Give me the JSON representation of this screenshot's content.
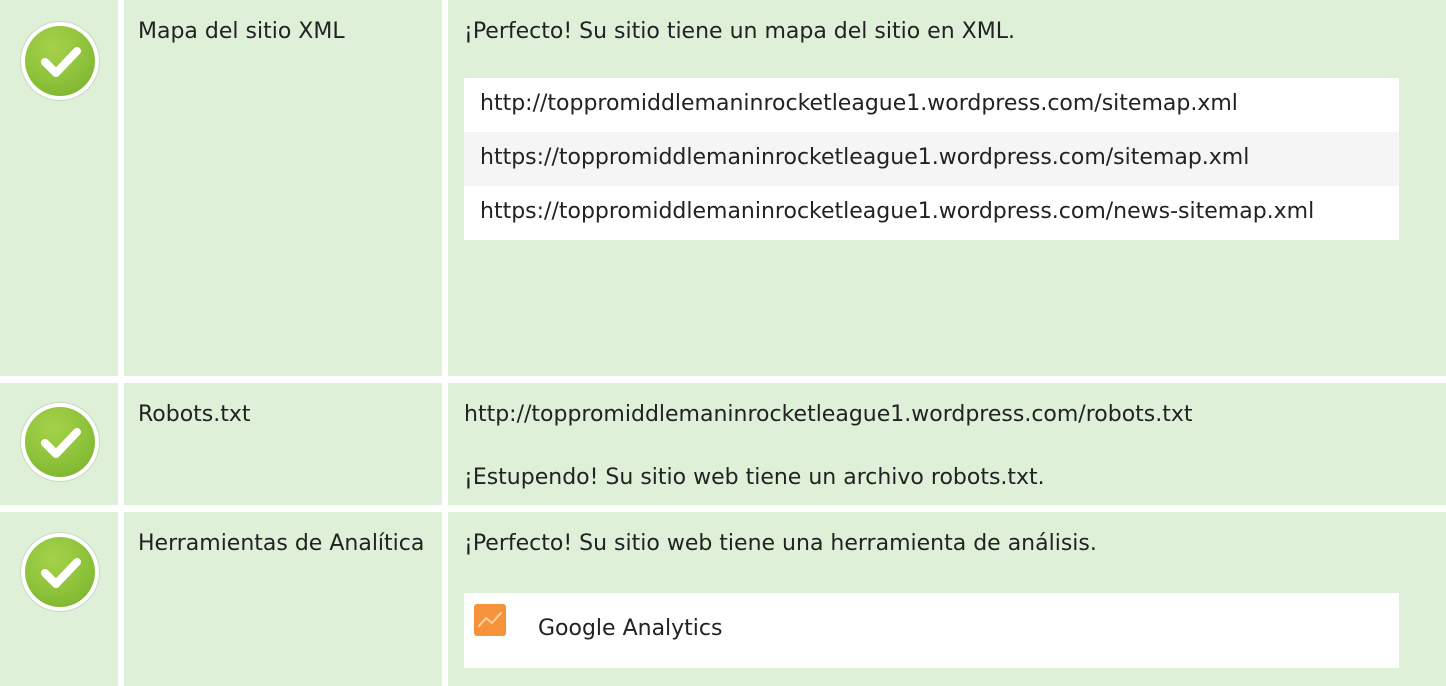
{
  "rows": [
    {
      "label": "Mapa del sitio XML",
      "status": "check-icon",
      "message": "¡Perfecto! Su sitio tiene un mapa del sitio en XML.",
      "urls": [
        "http://toppromiddlemaninrocketleague1.wordpress.com/sitemap.xml",
        "https://toppromiddlemaninrocketleague1.wordpress.com/sitemap.xml",
        "https://toppromiddlemaninrocketleague1.wordpress.com/news-sitemap.xml"
      ]
    },
    {
      "label": "Robots.txt",
      "status": "check-icon",
      "url": "http://toppromiddlemaninrocketleague1.wordpress.com/robots.txt",
      "message": "¡Estupendo! Su sitio web tiene un archivo robots.txt."
    },
    {
      "label": "Herramientas de Analítica",
      "status": "check-icon",
      "message": "¡Perfecto! Su sitio web tiene una herramienta de análisis.",
      "tool": {
        "name": "Google Analytics",
        "icon": "google-analytics-icon"
      }
    }
  ],
  "colors": {
    "row_bg": "#dff0d8",
    "check_green": "#8cc23a",
    "analytics_orange": "#f6923a"
  }
}
